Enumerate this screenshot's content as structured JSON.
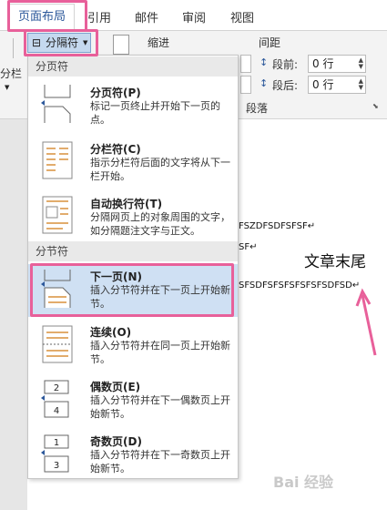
{
  "tabs": {
    "page_layout": "页面布局",
    "reference": "引用",
    "mailing": "邮件",
    "review": "审阅",
    "view": "视图"
  },
  "ribbon": {
    "left_group_label": "分栏",
    "separator_button": "分隔符",
    "indent_label": "缩进",
    "spacing_label": "间距",
    "before_label": "段前:",
    "after_label": "段后:",
    "before_value": "0 行",
    "after_value": "0 行",
    "paragraph_group": "段落"
  },
  "menu": {
    "page_breaks_header": "分页符",
    "section_breaks_header": "分节符",
    "items": [
      {
        "title": "分页符(P)",
        "desc": "标记一页终止并开始下一页的点。"
      },
      {
        "title": "分栏符(C)",
        "desc": "指示分栏符后面的文字将从下一栏开始。"
      },
      {
        "title": "自动换行符(T)",
        "desc": "分隔网页上的对象周围的文字，如分隔题注文字与正文。"
      },
      {
        "title": "下一页(N)",
        "desc": "插入分节符并在下一页上开始新节。"
      },
      {
        "title": "连续(O)",
        "desc": "插入分节符并在同一页上开始新节。"
      },
      {
        "title": "偶数页(E)",
        "desc": "插入分节符并在下一偶数页上开始新节。"
      },
      {
        "title": "奇数页(D)",
        "desc": "插入分节符并在下一奇数页上开始新节。"
      }
    ]
  },
  "document": {
    "line1": "FSZDFSDFSFSF↵",
    "line2": "SF↵",
    "line3": "SFSDFSFSFSFSFSFSDFSD↵",
    "annotation": "文章末尾"
  },
  "watermark": "Bai 经验",
  "colors": {
    "highlight": "#e8609a",
    "selected_item": "#cfe0f3",
    "accent": "#2b579a"
  }
}
